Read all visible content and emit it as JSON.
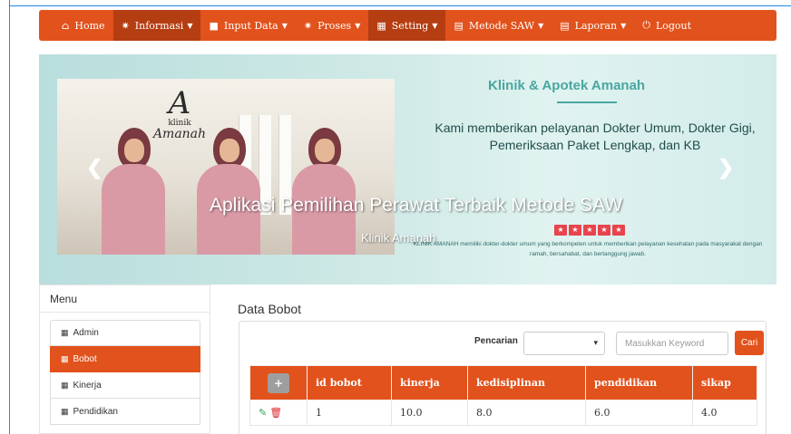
{
  "navbar": {
    "items": [
      {
        "label": "Home",
        "icon": "home-icon",
        "glyph": "⌂",
        "dropdown": false,
        "active": false
      },
      {
        "label": "Informasi",
        "icon": "gear-icon",
        "glyph": "✷",
        "dropdown": true,
        "active": true
      },
      {
        "label": "Input Data",
        "icon": "file-icon",
        "glyph": "■",
        "dropdown": true,
        "active": false
      },
      {
        "label": "Proses",
        "icon": "gear-icon",
        "glyph": "✷",
        "dropdown": true,
        "active": false
      },
      {
        "label": "Setting",
        "icon": "grid-icon",
        "glyph": "▦",
        "dropdown": true,
        "active": true
      },
      {
        "label": "Metode SAW",
        "icon": "list-icon",
        "glyph": "▤",
        "dropdown": true,
        "active": false
      },
      {
        "label": "Laporan",
        "icon": "list-icon",
        "glyph": "▤",
        "dropdown": true,
        "active": false
      },
      {
        "label": "Logout",
        "icon": "power-icon",
        "glyph": "⏻",
        "dropdown": false,
        "active": false
      }
    ]
  },
  "carousel": {
    "photo_sign_initial": "A",
    "photo_sign_small": "klinik",
    "photo_sign_name": "Amanah",
    "caption_title": "Aplikasi Pemilihan Perawat Terbaik Metode SAW",
    "caption_sub": "Klinik Amanah",
    "promo_title": "Klinik & Apotek Amanah",
    "promo_text": "Kami memberikan pelayanan Dokter Umum, Dokter Gigi, Pemeriksaan Paket Lengkap, dan KB",
    "promo_small": "KLINIK AMANAH memiliki dokter-dokter umum yang berkompeten untuk memberikan pelayanan kesehatan pada masyarakat dengan ramah, bersahabat, dan bertanggung jawab.",
    "stars": 5,
    "prev_glyph": "❮",
    "next_glyph": "❯"
  },
  "sidebar": {
    "title": "Menu",
    "items": [
      {
        "label": "Admin",
        "active": false
      },
      {
        "label": "Bobot",
        "active": true
      },
      {
        "label": "Kinerja",
        "active": false
      },
      {
        "label": "Pendidikan",
        "active": false
      }
    ]
  },
  "main": {
    "title": "Data Bobot",
    "search_label": "Pencarian",
    "search_placeholder": "Masukkan Keyword",
    "search_button": "Cari",
    "table": {
      "add_glyph": "+",
      "headers": [
        "id bobot",
        "kinerja",
        "kedisiplinan",
        "pendidikan",
        "sikap"
      ],
      "rows": [
        {
          "id": "1",
          "kinerja": "10.0",
          "kedisiplinan": "8.0",
          "pendidikan": "6.0",
          "sikap": "4.0"
        }
      ]
    }
  },
  "colors": {
    "accent": "#e2521c",
    "accent_dark": "#b53d12",
    "edit": "#2ea44f",
    "delete": "#d9282f"
  }
}
